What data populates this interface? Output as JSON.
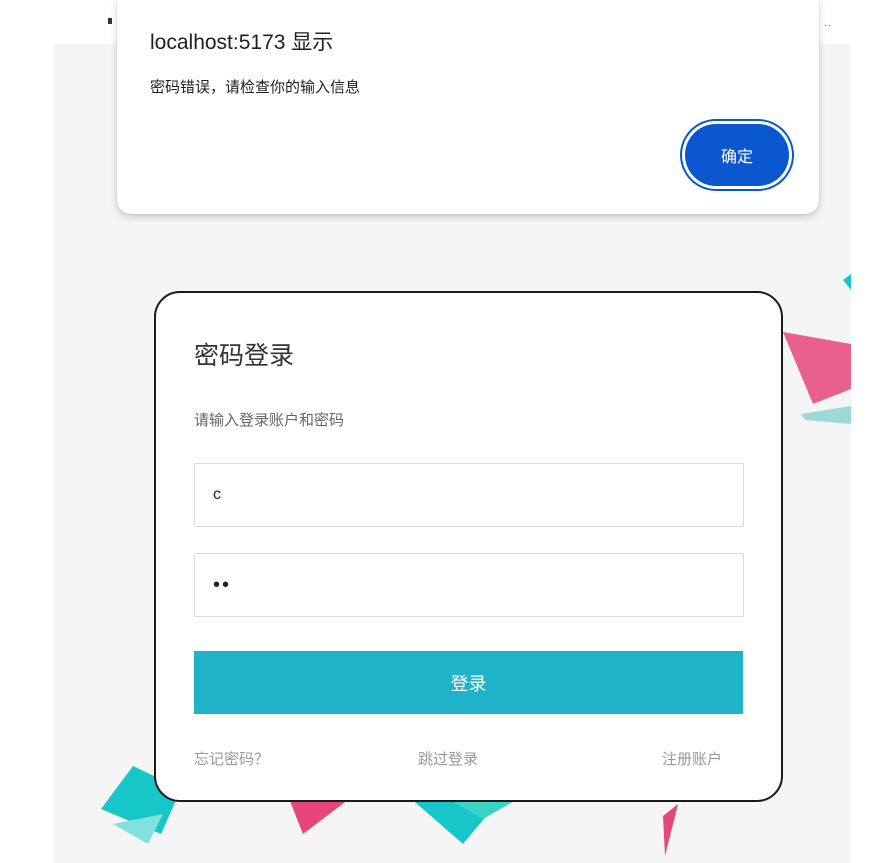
{
  "dialog": {
    "title": "localhost:5173 显示",
    "message": "密码错误，请检查你的输入信息",
    "ok_label": "确定"
  },
  "login": {
    "title": "密码登录",
    "subtitle": "请输入登录账户和密码",
    "username_value": "c",
    "password_masked": "••",
    "submit_label": "登录",
    "forgot_label": "忘记密码？",
    "skip_label": "跳过登录",
    "register_label": "注册账户"
  },
  "colors": {
    "accent": "#1fb3c9",
    "dialog_button": "#0b57d0",
    "decoration_pink": "#e8457a",
    "decoration_teal": "#17c6c9"
  }
}
